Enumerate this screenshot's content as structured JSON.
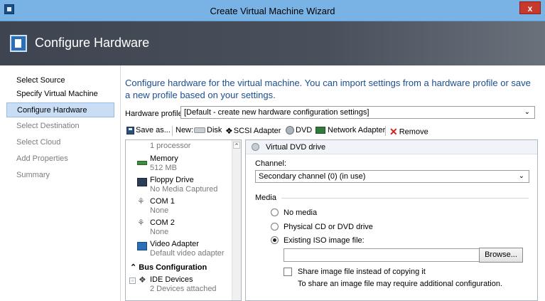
{
  "window": {
    "title": "Create Virtual Machine Wizard",
    "close_label": "x"
  },
  "header": {
    "title": "Configure Hardware"
  },
  "nav": {
    "items": [
      {
        "label": "Select Source",
        "state": "normal"
      },
      {
        "label": "Specify Virtual Machine Identity",
        "state": "normal"
      },
      {
        "label": "Configure Hardware",
        "state": "active"
      },
      {
        "label": "Select Destination",
        "state": "disabled"
      },
      {
        "label": "Select Cloud",
        "state": "disabled"
      },
      {
        "label": "Add Properties",
        "state": "disabled"
      },
      {
        "label": "Summary",
        "state": "disabled"
      }
    ]
  },
  "main": {
    "intro": "Configure hardware for the virtual machine. You can import settings from a hardware profile or save a new profile based on your settings.",
    "hardware_profile_label": "Hardware profile:",
    "hardware_profile_value": "[Default - create new hardware configuration settings]"
  },
  "toolbar": {
    "save_as": "Save as...",
    "new_label": "New:",
    "disk": "Disk",
    "scsi_adapter": "SCSI Adapter",
    "dvd": "DVD",
    "network_adapter": "Network Adapter",
    "remove": "Remove"
  },
  "hardware_list": {
    "top_partial": "1 processor",
    "items": [
      {
        "name": "Memory",
        "detail": "512 MB"
      },
      {
        "name": "Floppy Drive",
        "detail": "No Media Captured"
      },
      {
        "name": "COM 1",
        "detail": "None"
      },
      {
        "name": "COM 2",
        "detail": "None"
      },
      {
        "name": "Video Adapter",
        "detail": "Default video adapter"
      }
    ],
    "bus_header": "Bus Configuration",
    "ide": {
      "name": "IDE Devices",
      "detail": "2 Devices attached"
    }
  },
  "details": {
    "title": "Virtual DVD drive",
    "channel_label": "Channel:",
    "channel_value": "Secondary channel (0) (in use)",
    "media_label": "Media",
    "options": [
      {
        "label": "No media",
        "checked": false
      },
      {
        "label": "Physical CD or DVD drive",
        "checked": false
      },
      {
        "label": "Existing ISO image file:",
        "checked": true
      }
    ],
    "iso_path": "",
    "browse_label": "Browse...",
    "share_label": "Share image file instead of copying it",
    "share_note": "To share an image file may require additional configuration."
  },
  "colors": {
    "title_bar": "#79b2e4",
    "header_bg": "#4a505b",
    "accent_text": "#1c4e8f",
    "nav_active": "#c9def5",
    "remove": "#d2231b"
  }
}
